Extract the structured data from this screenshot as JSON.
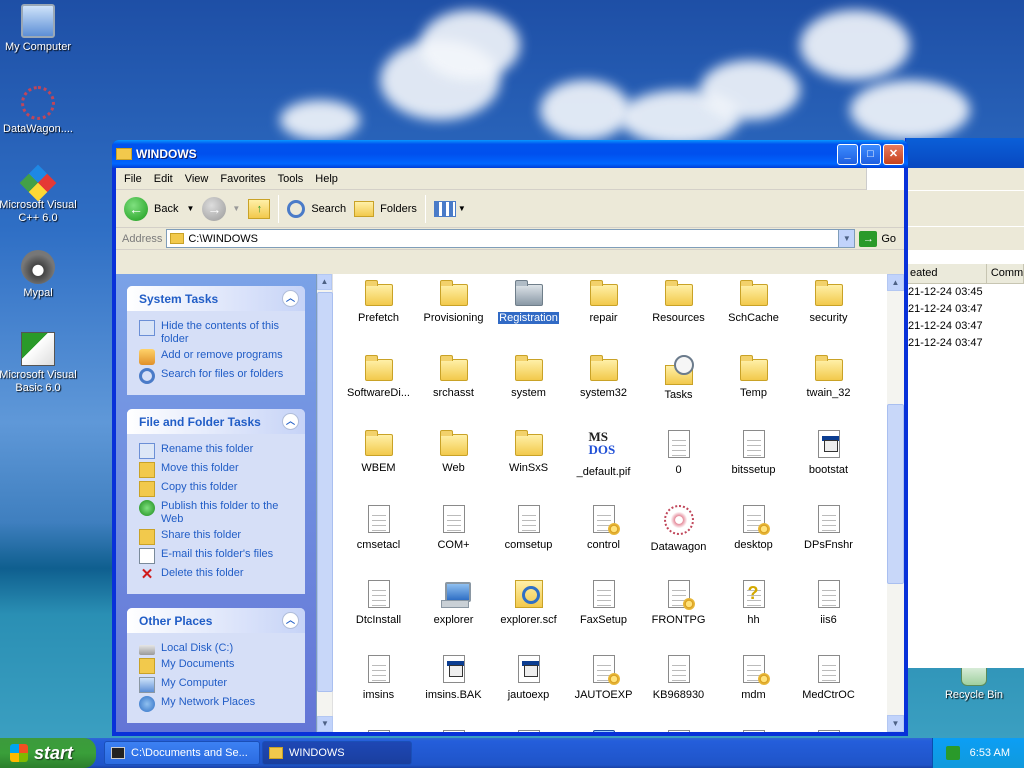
{
  "desktop": {
    "icons": [
      {
        "label": "My Computer",
        "icon": "my-computer-icon"
      },
      {
        "label": "DataWagon....",
        "icon": "datawagon-shortcut-icon"
      },
      {
        "label": "Microsoft Visual C++ 6.0",
        "icon": "visual-cpp-shortcut-icon"
      },
      {
        "label": "Mypal",
        "icon": "mypal-shortcut-icon"
      },
      {
        "label": "Microsoft Visual Basic 6.0",
        "icon": "visual-basic-shortcut-icon"
      },
      {
        "label": "Recycle Bin",
        "icon": "recycle-bin-icon"
      }
    ]
  },
  "background_window": {
    "columns": [
      "eated",
      "Comm"
    ],
    "rows": [
      "21-12-24 03:45",
      "21-12-24 03:47",
      "21-12-24 03:47",
      "21-12-24 03:47"
    ]
  },
  "window": {
    "title": "WINDOWS",
    "menu": [
      "File",
      "Edit",
      "View",
      "Favorites",
      "Tools",
      "Help"
    ],
    "toolbar": {
      "back": "Back",
      "search": "Search",
      "folders": "Folders"
    },
    "address": {
      "label": "Address",
      "value": "C:\\WINDOWS",
      "go": "Go"
    }
  },
  "sidebar": {
    "system_tasks": {
      "title": "System Tasks",
      "items": [
        "Hide the contents of this folder",
        "Add or remove programs",
        "Search for files or folders"
      ]
    },
    "file_folder_tasks": {
      "title": "File and Folder Tasks",
      "items": [
        "Rename this folder",
        "Move this folder",
        "Copy this folder",
        "Publish this folder to the Web",
        "Share this folder",
        "E-mail this folder's files",
        "Delete this folder"
      ]
    },
    "other_places": {
      "title": "Other Places",
      "items": [
        "Local Disk (C:)",
        "My Documents",
        "My Computer",
        "My Network Places"
      ]
    }
  },
  "files": [
    {
      "name": "Prefetch",
      "type": "folder"
    },
    {
      "name": "Provisioning",
      "type": "folder"
    },
    {
      "name": "Registration",
      "type": "folder-grey",
      "selected": true
    },
    {
      "name": "repair",
      "type": "folder"
    },
    {
      "name": "Resources",
      "type": "folder"
    },
    {
      "name": "SchCache",
      "type": "folder"
    },
    {
      "name": "security",
      "type": "folder"
    },
    {
      "name": "SoftwareDi...",
      "type": "folder"
    },
    {
      "name": "srchasst",
      "type": "folder"
    },
    {
      "name": "system",
      "type": "folder"
    },
    {
      "name": "system32",
      "type": "folder"
    },
    {
      "name": "Tasks",
      "type": "tasks"
    },
    {
      "name": "Temp",
      "type": "folder"
    },
    {
      "name": "twain_32",
      "type": "folder"
    },
    {
      "name": "WBEM",
      "type": "folder"
    },
    {
      "name": "Web",
      "type": "folder"
    },
    {
      "name": "WinSxS",
      "type": "folder"
    },
    {
      "name": "_default.pif",
      "type": "pif"
    },
    {
      "name": "0",
      "type": "file"
    },
    {
      "name": "bitssetup",
      "type": "file"
    },
    {
      "name": "bootstat",
      "type": "file-win"
    },
    {
      "name": "cmsetacl",
      "type": "file"
    },
    {
      "name": "COM+",
      "type": "file"
    },
    {
      "name": "comsetup",
      "type": "file"
    },
    {
      "name": "control",
      "type": "file-gear"
    },
    {
      "name": "Datawagon",
      "type": "star"
    },
    {
      "name": "desktop",
      "type": "file-gear"
    },
    {
      "name": "DPsFnshr",
      "type": "file"
    },
    {
      "name": "DtcInstall",
      "type": "file"
    },
    {
      "name": "explorer",
      "type": "pc"
    },
    {
      "name": "explorer.scf",
      "type": "scf"
    },
    {
      "name": "FaxSetup",
      "type": "file"
    },
    {
      "name": "FRONTPG",
      "type": "file-gear"
    },
    {
      "name": "hh",
      "type": "file-help"
    },
    {
      "name": "iis6",
      "type": "file"
    },
    {
      "name": "imsins",
      "type": "file"
    },
    {
      "name": "imsins.BAK",
      "type": "file-win"
    },
    {
      "name": "jautoexp",
      "type": "file-win"
    },
    {
      "name": "JAUTOEXP",
      "type": "file-gear"
    },
    {
      "name": "KB968930",
      "type": "file"
    },
    {
      "name": "mdm",
      "type": "file-gear"
    },
    {
      "name": "MedCtrOC",
      "type": "file"
    },
    {
      "name": "",
      "type": "file-gear"
    },
    {
      "name": "",
      "type": "file"
    },
    {
      "name": "",
      "type": "file"
    },
    {
      "name": "",
      "type": "blue"
    },
    {
      "name": "",
      "type": "file"
    },
    {
      "name": "",
      "type": "file"
    },
    {
      "name": "",
      "type": "file"
    }
  ],
  "taskbar": {
    "start": "start",
    "tasks": [
      {
        "label": "C:\\Documents and Se...",
        "active": false
      },
      {
        "label": "WINDOWS",
        "active": true
      }
    ],
    "clock": "6:53 AM"
  }
}
